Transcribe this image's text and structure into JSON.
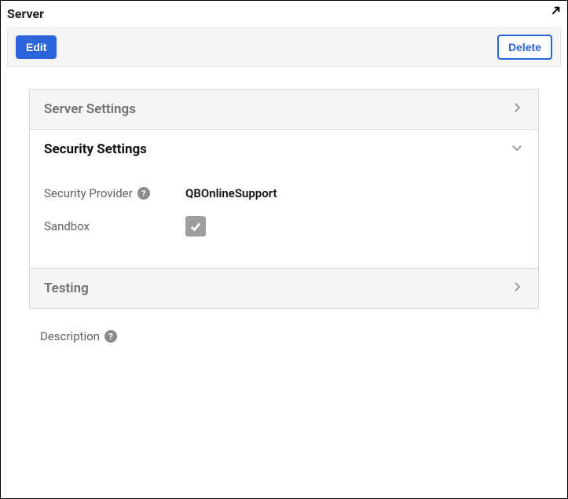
{
  "header": {
    "title": "Server"
  },
  "toolbar": {
    "edit_label": "Edit",
    "delete_label": "Delete"
  },
  "sections": {
    "server_settings": {
      "title": "Server Settings"
    },
    "security_settings": {
      "title": "Security Settings",
      "fields": {
        "security_provider": {
          "label": "Security Provider",
          "value": "QBOnlineSupport"
        },
        "sandbox": {
          "label": "Sandbox"
        }
      }
    },
    "testing": {
      "title": "Testing"
    }
  },
  "description": {
    "label": "Description"
  }
}
